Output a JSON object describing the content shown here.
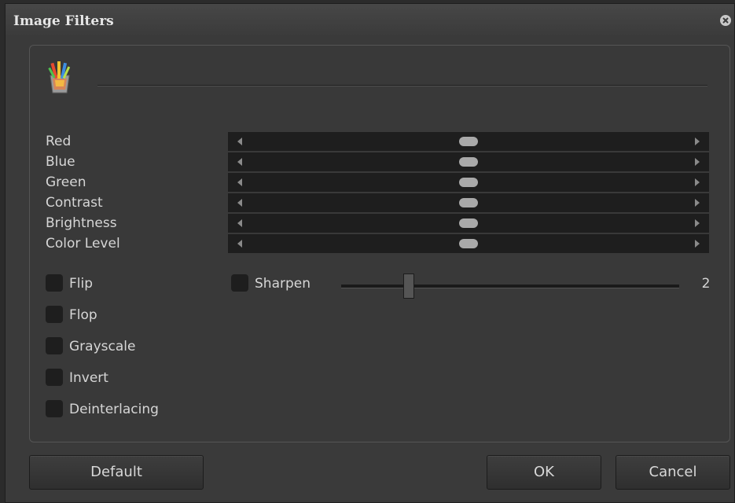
{
  "window": {
    "title": "Image Filters"
  },
  "adjustments": [
    {
      "label": "Red",
      "value": 0.5
    },
    {
      "label": "Blue",
      "value": 0.5
    },
    {
      "label": "Green",
      "value": 0.5
    },
    {
      "label": "Contrast",
      "value": 0.5
    },
    {
      "label": "Brightness",
      "value": 0.5
    },
    {
      "label": "Color Level",
      "value": 0.5
    }
  ],
  "checkboxes": [
    {
      "label": "Flip",
      "checked": false
    },
    {
      "label": "Flop",
      "checked": false
    },
    {
      "label": "Grayscale",
      "checked": false
    },
    {
      "label": "Invert",
      "checked": false
    },
    {
      "label": "Deinterlacing",
      "checked": false
    }
  ],
  "sharpen": {
    "label": "Sharpen",
    "checked": false,
    "value": "2",
    "level": 0.2
  },
  "buttons": {
    "default": "Default",
    "ok": "OK",
    "cancel": "Cancel"
  },
  "icons": {
    "logo": "brushes-cup-icon",
    "close": "close-icon"
  }
}
